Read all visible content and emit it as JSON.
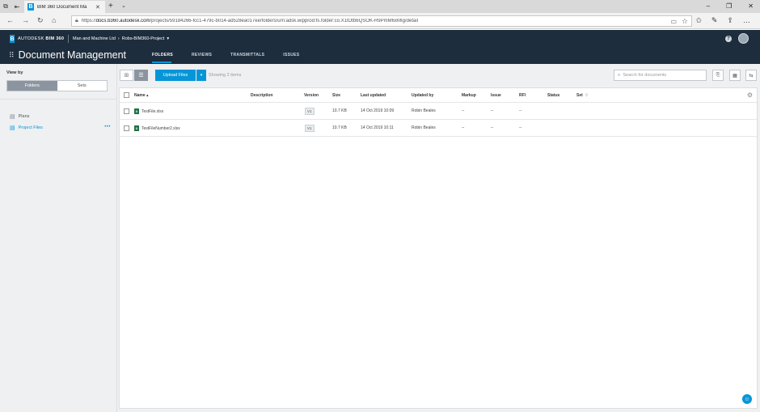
{
  "browser": {
    "tab_title": "BIM 360 Document Ma",
    "url_prefix": "https://",
    "url_host": "docs.b360.autodesk.com",
    "url_path": "/projects/59184266-fcc1-479c-b014-ad528ea017ee/folders/urn:adsk.wipprod:fs.folder:co.X1tOtb6QSOK-R9PmM6xMIg/detail"
  },
  "header": {
    "brand_prefix": "AUTODESK",
    "brand_product": "BIM 360",
    "account": "Man and Machine Ltd",
    "project": "Robs-BIM360-Project",
    "app_title": "Document Management",
    "tabs": [
      {
        "label": "FOLDERS",
        "active": true
      },
      {
        "label": "REVIEWS",
        "active": false
      },
      {
        "label": "TRANSMITTALS",
        "active": false
      },
      {
        "label": "ISSUES",
        "active": false
      }
    ]
  },
  "sidebar": {
    "view_by_label": "View by",
    "toggle": [
      {
        "label": "Folders",
        "active": true
      },
      {
        "label": "Sets",
        "active": false
      }
    ],
    "items": [
      {
        "label": "Plans",
        "selected": false
      },
      {
        "label": "Project Files",
        "selected": true
      }
    ]
  },
  "toolbar": {
    "upload_label": "Upload Files",
    "showing": "Showing 2 items",
    "search_placeholder": "Search for documents"
  },
  "table": {
    "headers": {
      "name": "Name",
      "description": "Description",
      "version": "Version",
      "size": "Size",
      "last_updated": "Last updated",
      "updated_by": "Updated by",
      "markup": "Markup",
      "issue": "Issue",
      "rfi": "RFI",
      "status": "Status",
      "set": "Set"
    },
    "rows": [
      {
        "name": "TestFile.xlsx",
        "version": "V1",
        "size": "10.7 KB",
        "last_updated": "14 Oct 2019 10:09",
        "updated_by": "Robin Beales",
        "markup": "--",
        "issue": "--",
        "rfi": "--"
      },
      {
        "name": "TestFileNumber2.xlsx",
        "version": "V1",
        "size": "10.7 KB",
        "last_updated": "14 Oct 2019 10:11",
        "updated_by": "Robin Beales",
        "markup": "--",
        "issue": "--",
        "rfi": "--"
      }
    ]
  },
  "colors": {
    "accent": "#0696d7",
    "header_bg": "#1e2d3d",
    "panel_bg": "#eef0f2"
  }
}
